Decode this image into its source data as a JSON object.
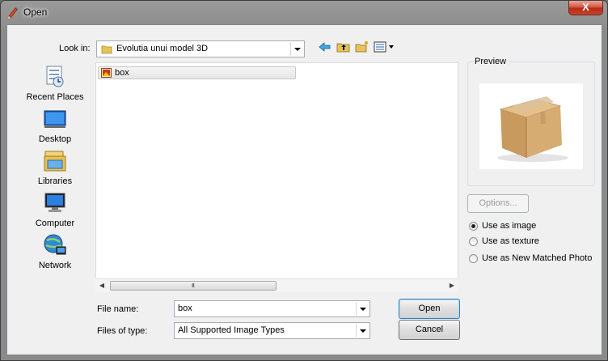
{
  "window": {
    "title": "Open",
    "close_label": "X"
  },
  "lookin": {
    "label": "Look in:",
    "value": "Evolutia unui model 3D"
  },
  "toolbar": {
    "icons": [
      "back-arrow-icon",
      "up-folder-icon",
      "new-folder-icon",
      "view-menu-icon"
    ]
  },
  "places": [
    {
      "label": "Recent Places",
      "icon": "recent-places-icon"
    },
    {
      "label": "Desktop",
      "icon": "desktop-icon"
    },
    {
      "label": "Libraries",
      "icon": "libraries-icon"
    },
    {
      "label": "Computer",
      "icon": "computer-icon"
    },
    {
      "label": "Network",
      "icon": "network-icon"
    }
  ],
  "files": [
    {
      "name": "box",
      "icon": "image-file-icon"
    }
  ],
  "scrollbar": {
    "grip": "III"
  },
  "filename": {
    "label": "File name:",
    "value": "box"
  },
  "filetype": {
    "label": "Files of type:",
    "value": "All Supported Image Types"
  },
  "buttons": {
    "open": "Open",
    "cancel": "Cancel",
    "options": "Options..."
  },
  "preview": {
    "label": "Preview"
  },
  "radios": [
    {
      "label": "Use as image",
      "checked": true
    },
    {
      "label": "Use as texture",
      "checked": false
    },
    {
      "label": "Use as New Matched Photo",
      "checked": false
    }
  ],
  "colors": {
    "selection": "#e6e6e6",
    "title_glow": "#ffffff",
    "close": "#c8442b"
  }
}
